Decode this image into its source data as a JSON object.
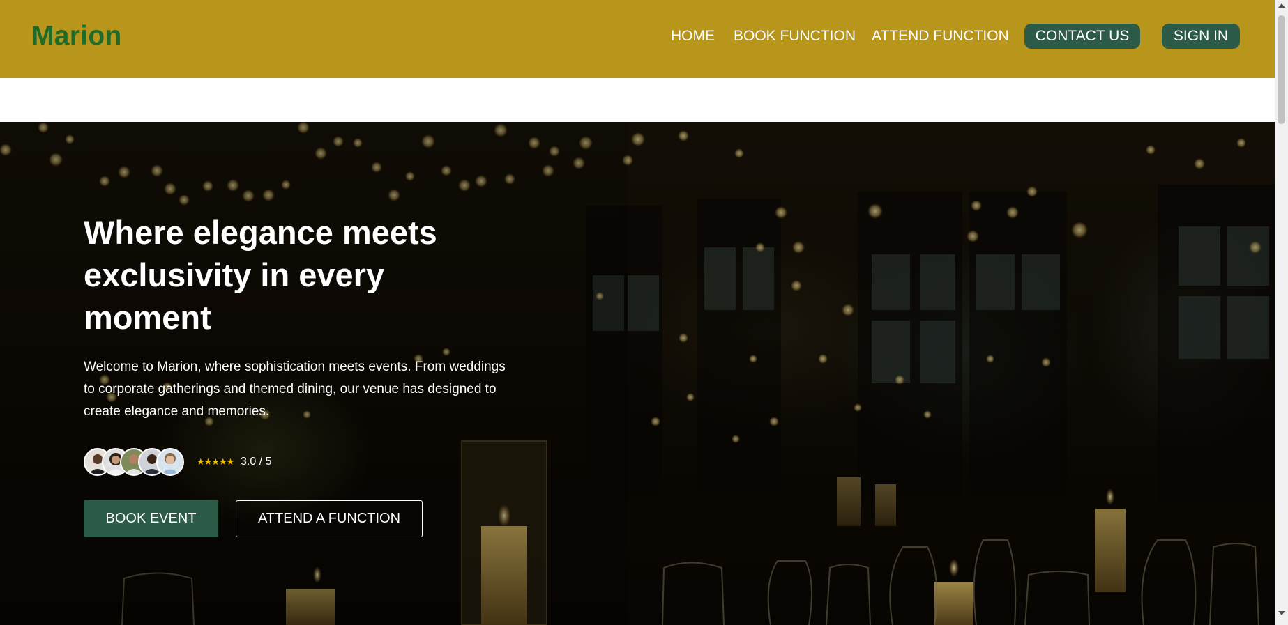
{
  "header": {
    "brand": "Marion",
    "nav": {
      "home": "HOME",
      "book_function": "BOOK FUNCTION",
      "attend_function": "ATTEND FUNCTION",
      "contact_us": "CONTACT US",
      "sign_in": "SIGN IN"
    }
  },
  "hero": {
    "title": "Where elegance meets exclusivity in every moment",
    "description": "Welcome to Marion, where sophistication meets events. From weddings to corporate gatherings and themed dining, our venue has designed to create elegance and memories.",
    "rating": {
      "stars": "★★★★★",
      "value": "3.0 / 5",
      "avatar_count": 5
    },
    "buttons": {
      "book_event": "BOOK EVENT",
      "attend_a_function": "ATTEND A FUNCTION"
    }
  },
  "colors": {
    "header_background": "#b8961b",
    "brand_text": "#1f6c2a",
    "button_green": "#2c5c48",
    "star_gold": "#f2c200"
  }
}
